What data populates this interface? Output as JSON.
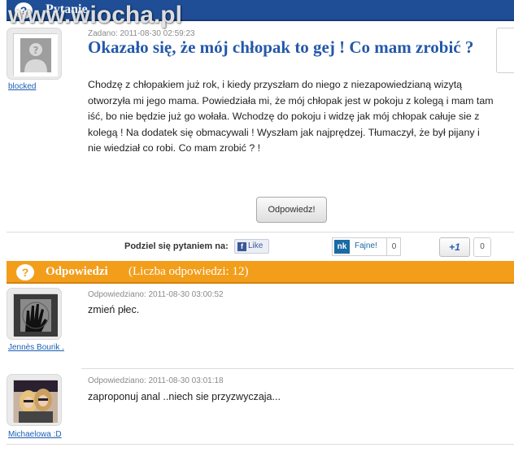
{
  "watermark": "www.wiocha.pl",
  "question_section": {
    "header_title": "Pytanie",
    "author": "blocked",
    "meta": "Zadano: 2011-08-30 02:59:23",
    "title": "Okazało się, że mój chłopak to gej ! Co mam zrobić ?",
    "body": "Chodzę z chłopakiem już rok, i kiedy przyszłam do niego z niezapowiedzianą wizytą otworzyła mi jego mama. Powiedziała mi, że mój chłopak jest w pokoju z kolegą i mam tam iść, bo nie będzie już go wołała. Wchodzę do pokoju i widzę jak mój chłopak całuje sie z kolegą ! Na dodatek się obmacywali ! Wyszłam jak najprędzej. Tłumaczył, że był pijany i nie wiedział co robi. Co mam zrobić ? !",
    "reply_button": "Odpowiedz!"
  },
  "share": {
    "label": "Podziel się pytaniem na:",
    "fb_like": "Like",
    "nk_logo": "nk",
    "nk_label": "Fajne!",
    "nk_count": "0",
    "gplus_label": "+1",
    "gplus_count": "0"
  },
  "answers_section": {
    "header_title": "Odpowiedzi",
    "header_count": "(Liczba odpowiedzi: 12)",
    "items": [
      {
        "author": "Jennès Bourik .",
        "meta": "Odpowiedziano: 2011-08-30 03:00:52",
        "text": "zmień płec."
      },
      {
        "author": "Michaelowa :D",
        "meta": "Odpowiedziano: 2011-08-30 03:01:18",
        "text": "zaproponuj anal ..niech sie przyzwyczaja..."
      }
    ]
  },
  "colors": {
    "question_header": "#1f4e96",
    "answers_header": "#f29e1b",
    "title_blue": "#2458a8",
    "link_blue": "#1a5fb4"
  }
}
